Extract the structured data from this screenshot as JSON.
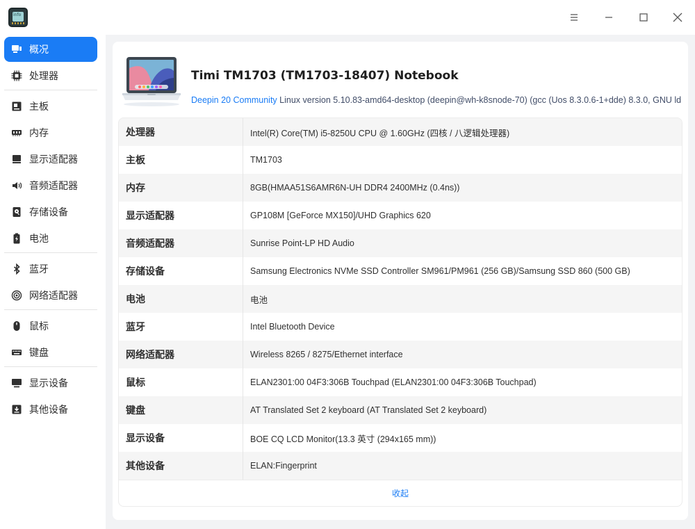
{
  "window": {
    "app_icon_text": "info",
    "controls": [
      "menu",
      "minimize",
      "maximize",
      "close"
    ]
  },
  "sidebar": {
    "groups": [
      [
        {
          "key": "overview",
          "label": "概况",
          "icon": "monitor-overview-icon",
          "active": true
        },
        {
          "key": "cpu",
          "label": "处理器",
          "icon": "cpu-chip-icon"
        }
      ],
      [
        {
          "key": "board",
          "label": "主板",
          "icon": "motherboard-icon"
        },
        {
          "key": "memory",
          "label": "内存",
          "icon": "memory-icon"
        },
        {
          "key": "gpu",
          "label": "显示适配器",
          "icon": "display-adapter-icon"
        },
        {
          "key": "audio",
          "label": "音频适配器",
          "icon": "speaker-icon"
        },
        {
          "key": "storage",
          "label": "存储设备",
          "icon": "storage-disk-icon"
        },
        {
          "key": "battery",
          "label": "电池",
          "icon": "battery-icon"
        }
      ],
      [
        {
          "key": "bluetooth",
          "label": "蓝牙",
          "icon": "bluetooth-icon"
        },
        {
          "key": "network",
          "label": "网络适配器",
          "icon": "network-icon"
        }
      ],
      [
        {
          "key": "mouse",
          "label": "鼠标",
          "icon": "mouse-icon"
        },
        {
          "key": "keyboard",
          "label": "键盘",
          "icon": "keyboard-icon"
        }
      ],
      [
        {
          "key": "display",
          "label": "显示设备",
          "icon": "monitor-icon"
        },
        {
          "key": "other",
          "label": "其他设备",
          "icon": "other-device-icon"
        }
      ]
    ]
  },
  "overview": {
    "title": "Timi TM1703 (TM1703-18407) Notebook",
    "os_link": "Deepin 20 Community",
    "os_detail": " Linux version 5.10.83-amd64-desktop (deepin@wh-k8snode-70) (gcc (Uos 8.3.0.6-1+dde) 8.3.0, GNU ld …",
    "rows": [
      {
        "label": "处理器",
        "value": "Intel(R) Core(TM) i5-8250U CPU @ 1.60GHz (四核 / 八逻辑处理器)"
      },
      {
        "label": "主板",
        "value": "TM1703"
      },
      {
        "label": "内存",
        "value": "8GB(HMAA51S6AMR6N-UH DDR4 2400MHz (0.4ns))"
      },
      {
        "label": "显示适配器",
        "value": "GP108M [GeForce MX150]/UHD Graphics 620"
      },
      {
        "label": "音频适配器",
        "value": "Sunrise Point-LP HD Audio"
      },
      {
        "label": "存储设备",
        "value": "Samsung Electronics NVMe SSD Controller SM961/PM961 (256 GB)/Samsung SSD 860 (500 GB)"
      },
      {
        "label": "电池",
        "value": "电池"
      },
      {
        "label": "蓝牙",
        "value": "Intel Bluetooth Device"
      },
      {
        "label": "网络适配器",
        "value": "Wireless 8265 / 8275/Ethernet interface"
      },
      {
        "label": "鼠标",
        "value": "ELAN2301:00 04F3:306B Touchpad (ELAN2301:00 04F3:306B Touchpad)"
      },
      {
        "label": "键盘",
        "value": "AT Translated Set 2 keyboard (AT Translated Set 2 keyboard)"
      },
      {
        "label": "显示设备",
        "value": "BOE CQ LCD Monitor(13.3 英寸 (294x165 mm))"
      },
      {
        "label": "其他设备",
        "value": "ELAN:Fingerprint"
      }
    ],
    "collapse_label": "收起"
  },
  "colors": {
    "accent": "#1a7cf5",
    "content_bg": "#f2f3f5",
    "row_alt": "#f5f5f5"
  }
}
